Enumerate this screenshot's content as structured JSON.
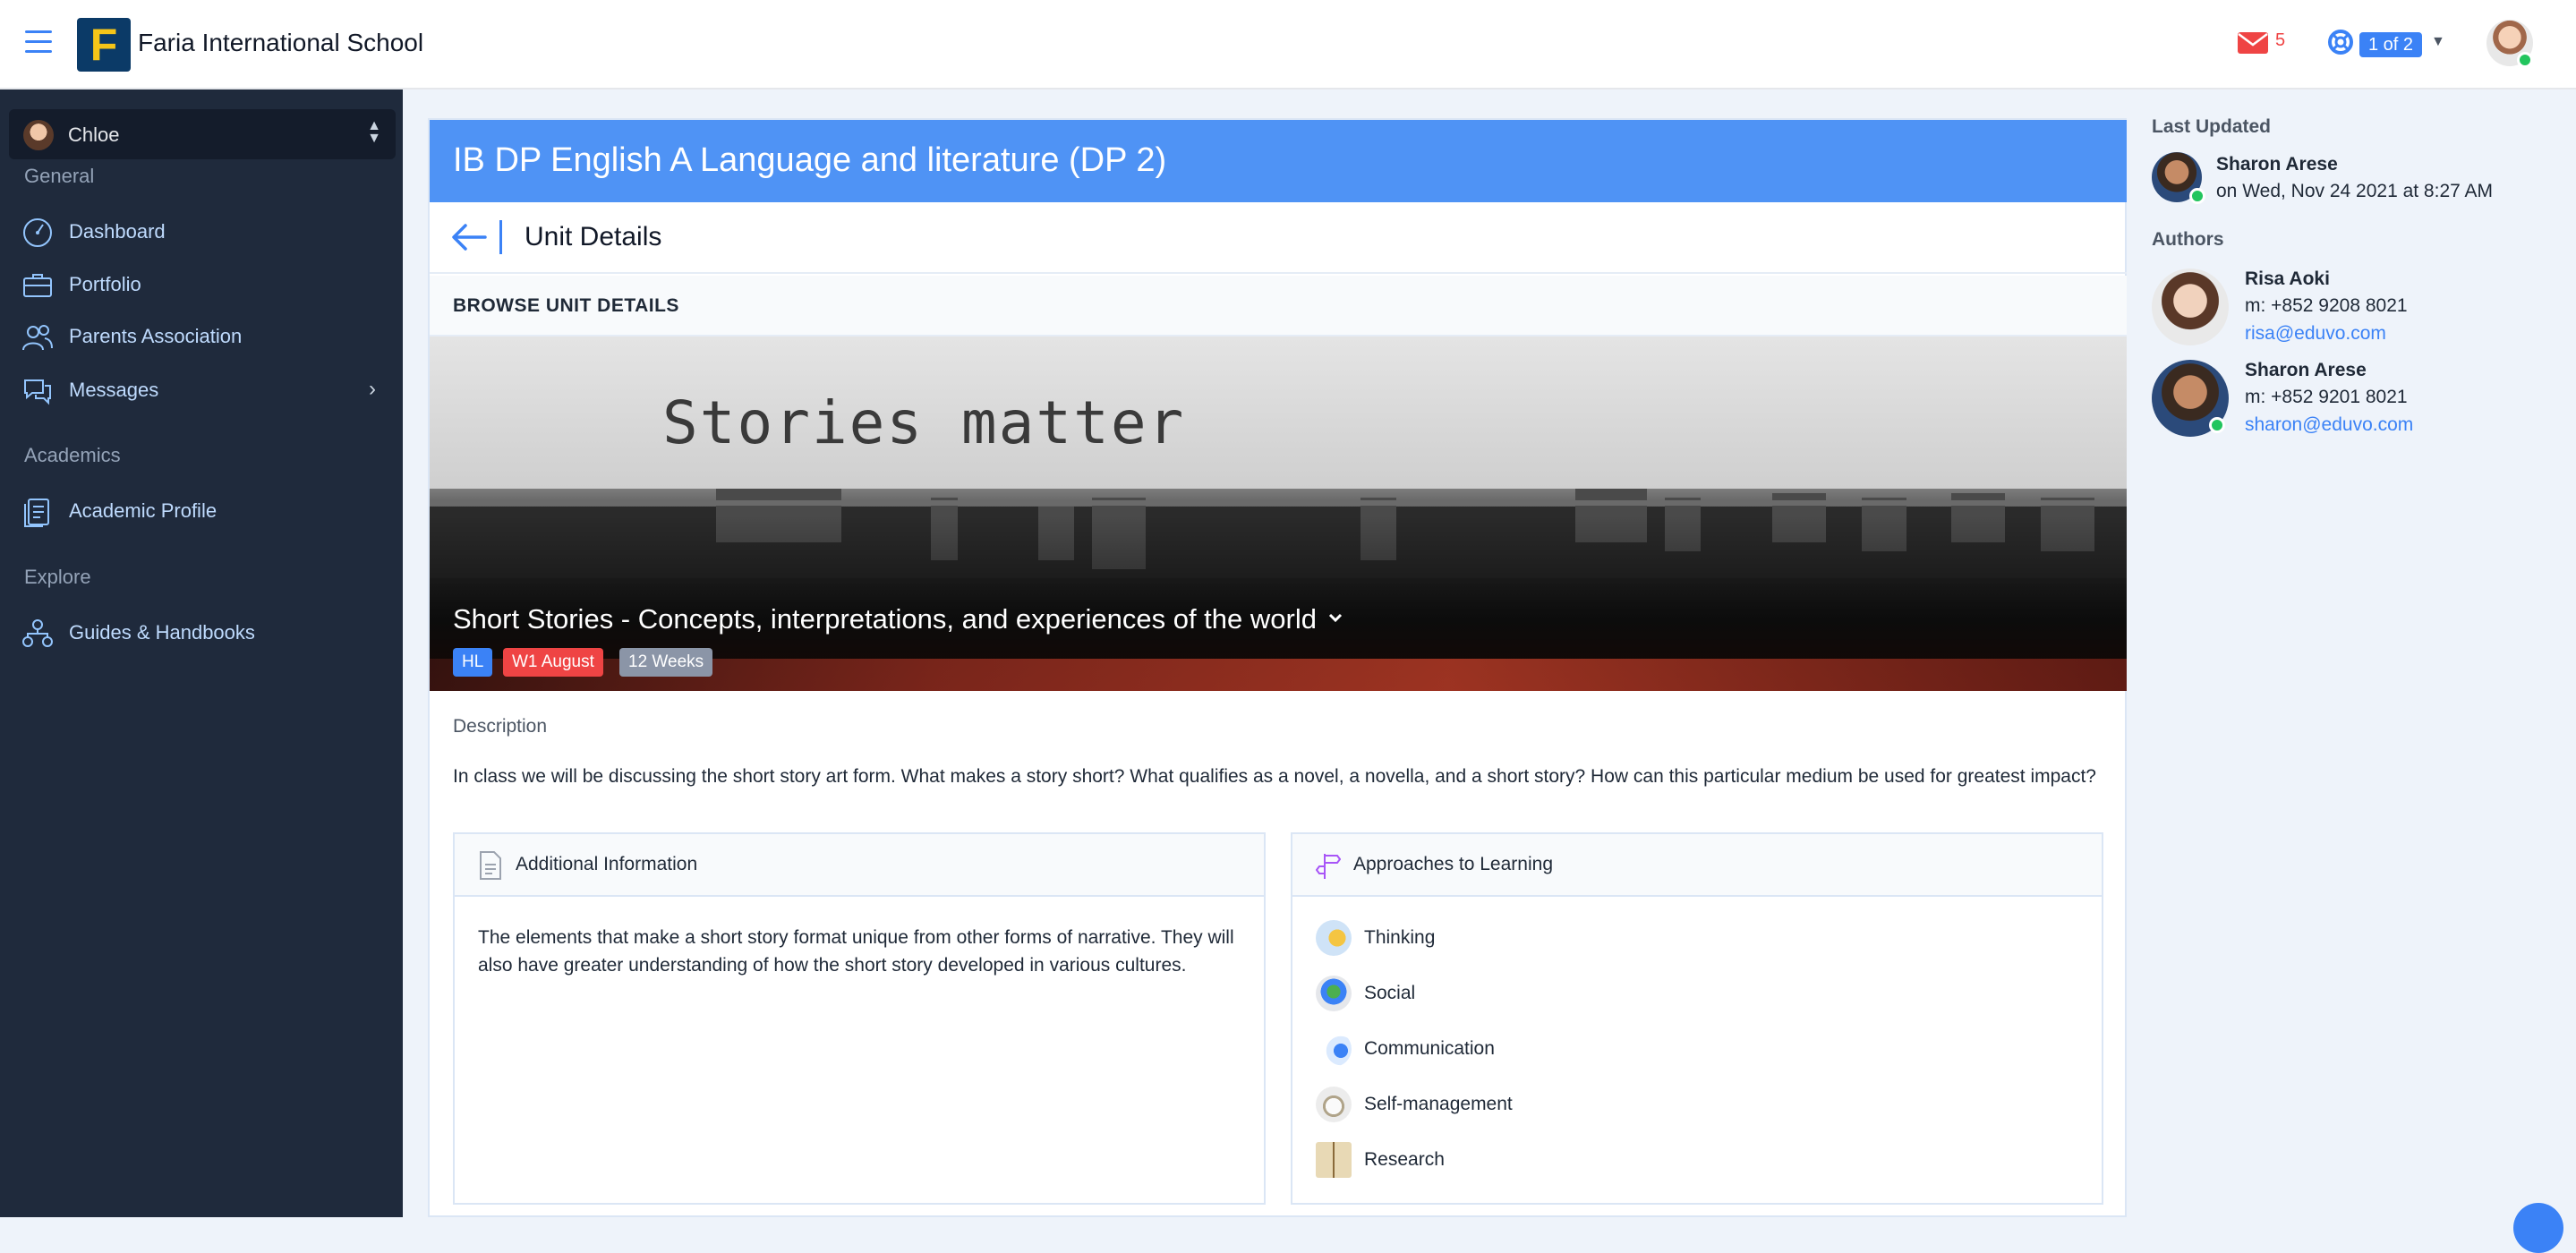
{
  "header": {
    "school_name": "Faria International School",
    "logo_letter": "F",
    "mail_count": "5",
    "pager": "1 of 2"
  },
  "sidebar": {
    "current_user": "Chloe",
    "sections": [
      {
        "label": "General",
        "items": [
          {
            "label": "Dashboard",
            "icon": "dashboard-gauge-icon"
          },
          {
            "label": "Portfolio",
            "icon": "briefcase-icon"
          },
          {
            "label": "Parents Association",
            "icon": "people-icon"
          },
          {
            "label": "Messages",
            "icon": "chat-bubbles-icon",
            "has_submenu": true
          }
        ]
      },
      {
        "label": "Academics",
        "items": [
          {
            "label": "Academic Profile",
            "icon": "document-stack-icon"
          }
        ]
      },
      {
        "label": "Explore",
        "items": [
          {
            "label": "Guides & Handbooks",
            "icon": "org-chart-icon"
          }
        ]
      }
    ]
  },
  "main": {
    "course_title": "IB DP English A Language and literature (DP 2)",
    "unit_header": "Unit Details",
    "browse_label": "BROWSE UNIT DETAILS",
    "hero": {
      "image_text": "Stories matter",
      "title": "Short Stories - Concepts, interpretations, and experiences of the world",
      "badges": [
        "HL",
        "W1 August",
        "12 Weeks"
      ]
    },
    "description_label": "Description",
    "description": "In class we will be discussing the short story art form. What makes a story short? What qualifies as a novel, a novella, and a short story? How can this particular medium be used for greatest impact?",
    "additional_info": {
      "title": "Additional Information",
      "body": "The elements that make a short story format unique from other forms of narrative. They will also have greater understanding of how the short story developed in various cultures."
    },
    "atl": {
      "title": "Approaches to Learning",
      "items": [
        "Thinking",
        "Social",
        "Communication",
        "Self-management",
        "Research"
      ]
    }
  },
  "right_panel": {
    "last_updated_label": "Last Updated",
    "last_updated_by": "Sharon Arese",
    "last_updated_on": "on Wed, Nov 24 2021 at 8:27 AM",
    "authors_label": "Authors",
    "authors": [
      {
        "name": "Risa Aoki",
        "mobile": "m: +852 9208 8021",
        "email": "risa@eduvo.com"
      },
      {
        "name": "Sharon Arese",
        "mobile": "m: +852 9201 8021",
        "email": "sharon@eduvo.com"
      }
    ]
  },
  "colors": {
    "accent": "#3b82f6",
    "sidebar_bg": "#1f2a3c",
    "course_bar": "#4f93f5",
    "badge_red": "#ef4444",
    "badge_gray": "#8b95a7",
    "online": "#22c55e"
  }
}
